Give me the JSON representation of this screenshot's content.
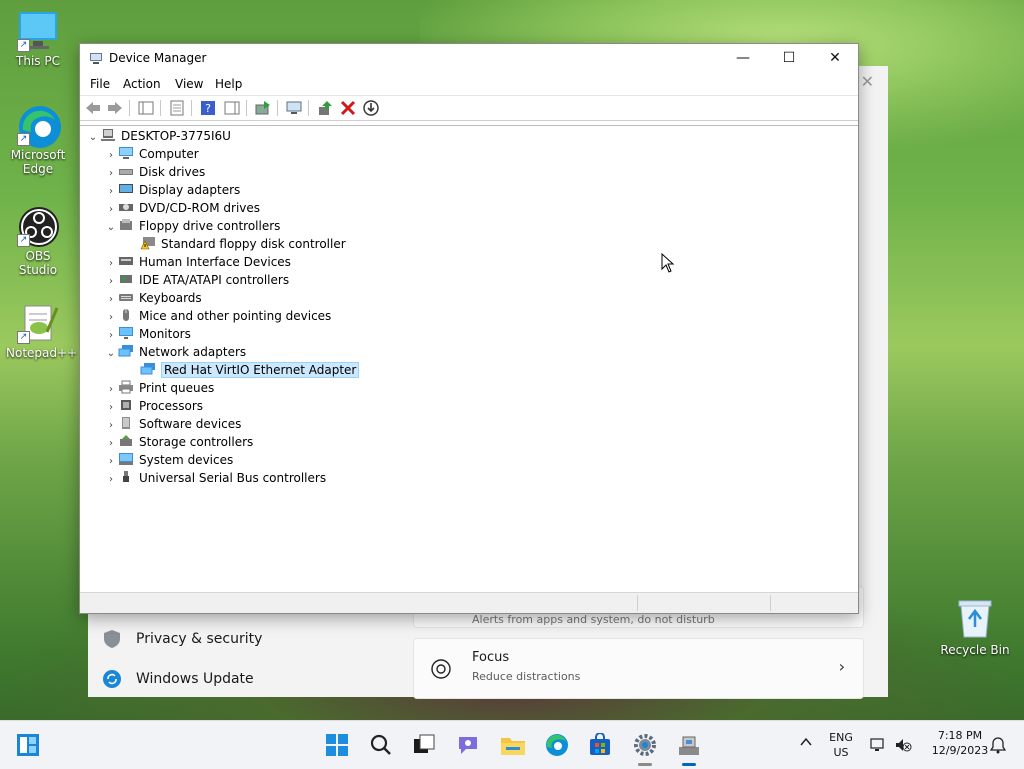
{
  "desktop": {
    "icons": [
      {
        "label": "This PC"
      },
      {
        "label": "Microsoft Edge"
      },
      {
        "label": "OBS Studio"
      },
      {
        "label": "Notepad++"
      }
    ],
    "recycle_bin": "Recycle Bin"
  },
  "settings_window": {
    "nav": [
      {
        "label": "Privacy & security",
        "icon": "shield-icon"
      },
      {
        "label": "Windows Update",
        "icon": "refresh-icon"
      }
    ],
    "faded_card_text": "Alerts from apps and system, do not disturb",
    "focus_card": {
      "title": "Focus",
      "subtitle": "Reduce distractions"
    }
  },
  "device_manager": {
    "title": "Device Manager",
    "menu": [
      "File",
      "Action",
      "View",
      "Help"
    ],
    "root": "DESKTOP-3775I6U",
    "tree": [
      {
        "label": "Computer",
        "expanded": false,
        "icon": "computer-icon"
      },
      {
        "label": "Disk drives",
        "expanded": false,
        "icon": "disk-icon"
      },
      {
        "label": "Display adapters",
        "expanded": false,
        "icon": "display-adapter-icon"
      },
      {
        "label": "DVD/CD-ROM drives",
        "expanded": false,
        "icon": "dvd-icon"
      },
      {
        "label": "Floppy drive controllers",
        "expanded": true,
        "icon": "floppy-controller-icon"
      },
      {
        "label": "Standard floppy disk controller",
        "child": true,
        "icon": "warning-device-icon"
      },
      {
        "label": "Human Interface Devices",
        "expanded": false,
        "icon": "hid-icon"
      },
      {
        "label": "IDE ATA/ATAPI controllers",
        "expanded": false,
        "icon": "ide-icon"
      },
      {
        "label": "Keyboards",
        "expanded": false,
        "icon": "keyboard-icon"
      },
      {
        "label": "Mice and other pointing devices",
        "expanded": false,
        "icon": "mouse-icon"
      },
      {
        "label": "Monitors",
        "expanded": false,
        "icon": "monitor-icon"
      },
      {
        "label": "Network adapters",
        "expanded": true,
        "icon": "network-icon"
      },
      {
        "label": "Red Hat VirtIO Ethernet Adapter",
        "child": true,
        "selected": true,
        "icon": "network-icon"
      },
      {
        "label": "Print queues",
        "expanded": false,
        "icon": "printer-icon"
      },
      {
        "label": "Processors",
        "expanded": false,
        "icon": "processor-icon"
      },
      {
        "label": "Software devices",
        "expanded": false,
        "icon": "software-icon"
      },
      {
        "label": "Storage controllers",
        "expanded": false,
        "icon": "storage-icon"
      },
      {
        "label": "System devices",
        "expanded": false,
        "icon": "system-icon"
      },
      {
        "label": "Universal Serial Bus controllers",
        "expanded": false,
        "icon": "usb-icon"
      }
    ]
  },
  "taskbar": {
    "lang_line1": "ENG",
    "lang_line2": "US",
    "time": "7:18 PM",
    "date": "12/9/2023"
  },
  "colors": {
    "accent": "#0067c0",
    "selection": "#cce8ff"
  }
}
